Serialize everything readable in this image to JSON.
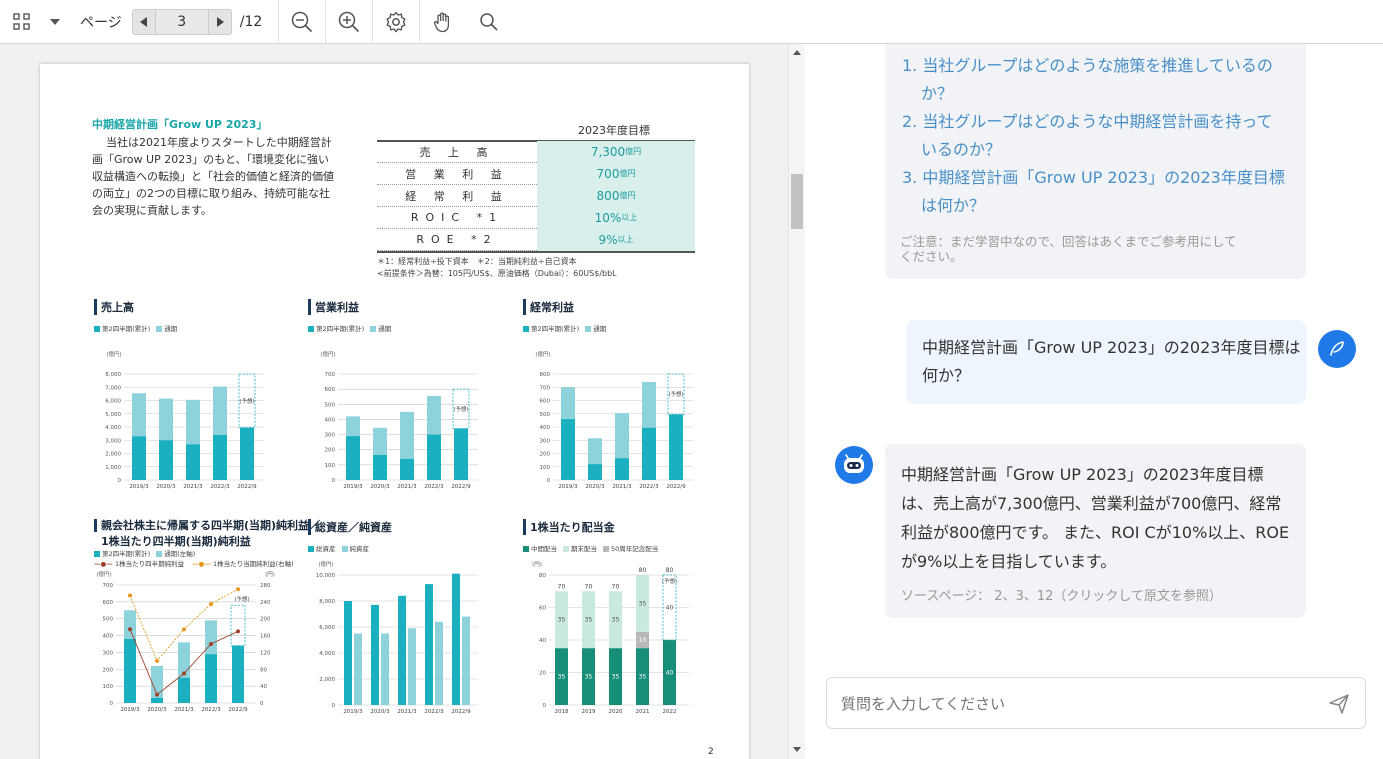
{
  "toolbar": {
    "page_label": "ページ",
    "current_page": "3",
    "total_pages": "/12"
  },
  "pdf": {
    "section_title": "中期経営計画「Grow UP 2023」",
    "intro": [
      "当社は2021年度よりスタートした中期経営計",
      "画「Grow UP 2023」のもと、「環境変化に強い",
      "収益構造への転換」と「社会的価値と経済的価値",
      "の両立」の2つの目標に取り組み、持続可能な社",
      "会の実現に貢献します。"
    ],
    "targets_header": "2023年度目標",
    "targets": [
      {
        "label": "売 上 高",
        "value": "7,300",
        "unit": "億円"
      },
      {
        "label": "営 業 利 益",
        "value": "700",
        "unit": "億円"
      },
      {
        "label": "経 常 利 益",
        "value": "800",
        "unit": "億円"
      },
      {
        "label": "ROIC *1",
        "value": "10%",
        "unit": "以上"
      },
      {
        "label": "ROE *2",
        "value": "9%",
        "unit": "以上"
      }
    ],
    "footnote1": "＊1：経常利益÷投下資本　＊2：当期純利益÷自己資本",
    "footnote2": "<前提条件＞為替：105円/US$、原油価格（Dubai）：60US$/bbL",
    "page_number": "2",
    "colors": {
      "dark": "#1ab0bf",
      "light": "#8ed3dc",
      "green": "#178f78",
      "pale": "#c9e8e0"
    },
    "charts": [
      {
        "title": "売上高",
        "unit": "(億円)",
        "legend": [
          "第2四半期(累計)",
          "通期"
        ],
        "yticks": [
          "8,000",
          "7,000",
          "6,000",
          "5,000",
          "4,000",
          "3,000",
          "2,000",
          "1,000",
          "0"
        ],
        "ymax": 8000,
        "cats": [
          "2019/3",
          "2020/3",
          "2021/3",
          "2022/3",
          "2022/9"
        ],
        "h1": [
          3300,
          3000,
          2700,
          3400,
          3950
        ],
        "total": [
          6550,
          6150,
          6050,
          7050,
          8000
        ],
        "note": "(予想)"
      },
      {
        "title": "営業利益",
        "unit": "(億円)",
        "legend": [
          "第2四半期(累計)",
          "通期"
        ],
        "yticks": [
          "700",
          "600",
          "500",
          "400",
          "300",
          "200",
          "100",
          "0"
        ],
        "ymax": 700,
        "cats": [
          "2019/3",
          "2020/3",
          "2021/3",
          "2022/3",
          "2022/9"
        ],
        "h1": [
          290,
          165,
          140,
          300,
          340
        ],
        "total": [
          420,
          345,
          450,
          555,
          600
        ],
        "note": "(予想)"
      },
      {
        "title": "経常利益",
        "unit": "(億円)",
        "legend": [
          "第2四半期(累計)",
          "通期"
        ],
        "yticks": [
          "800",
          "700",
          "600",
          "500",
          "400",
          "300",
          "200",
          "100",
          "0"
        ],
        "ymax": 800,
        "cats": [
          "2019/3",
          "2020/3",
          "2021/3",
          "2022/3",
          "2022/9"
        ],
        "h1": [
          460,
          120,
          165,
          395,
          495
        ],
        "total": [
          700,
          315,
          505,
          740,
          800
        ],
        "note": "(予想)"
      }
    ],
    "bottom_charts": [
      {
        "title": "親会社株主に帰属する四半期(当期)純利益／",
        "title2": "1株当たり四半期(当期)純利益",
        "legend": [
          "第2四半期(累計)",
          "通期(左軸)",
          "1株当たり四半期純利益",
          "1株当たり当期純利益(右軸)"
        ],
        "unit_l": "(億円)",
        "unit_r": "(円)",
        "yticks": [
          "700",
          "600",
          "500",
          "400",
          "300",
          "200",
          "100",
          "0"
        ],
        "rticks": [
          "280",
          "240",
          "200",
          "160",
          "120",
          "80",
          "40",
          "0"
        ],
        "ymax": 700,
        "cats": [
          "2019/3",
          "2020/3",
          "2021/3",
          "2022/3",
          "2022/9"
        ],
        "h1": [
          380,
          30,
          150,
          290,
          340
        ],
        "total": [
          550,
          220,
          360,
          490,
          580
        ],
        "eps_h1": [
          175,
          20,
          70,
          140,
          170
        ],
        "eps_full": [
          255,
          100,
          175,
          235,
          270
        ],
        "note": "(予想)"
      },
      {
        "title": "総資産／純資産",
        "legend": [
          "総資産",
          "純資産"
        ],
        "unit": "(億円)",
        "yticks": [
          "10,000",
          "8,000",
          "6,000",
          "4,000",
          "2,000",
          "0"
        ],
        "ymax": 10000,
        "cats": [
          "2019/3",
          "2020/3",
          "2021/3",
          "2022/3",
          "2022/9"
        ],
        "a": [
          8000,
          7700,
          8400,
          9300,
          10100
        ],
        "b": [
          5500,
          5500,
          5900,
          6400,
          6800
        ]
      },
      {
        "title": "1株当たり配当金",
        "legend": [
          "中間配当",
          "期末配当",
          "50周年記念配当"
        ],
        "unit": "(円)",
        "yticks": [
          "80",
          "60",
          "40",
          "20",
          "0"
        ],
        "ymax": 80,
        "cats": [
          "2018",
          "2019",
          "2020",
          "2021",
          "2022"
        ],
        "mid": [
          35,
          35,
          35,
          35,
          40
        ],
        "end": [
          35,
          35,
          35,
          35,
          40
        ],
        "anniv": [
          0,
          0,
          0,
          10,
          0
        ],
        "totals": [
          "70",
          "70",
          "70",
          "80",
          "80"
        ],
        "mid_labels": [
          "35",
          "35",
          "35",
          "35",
          "40"
        ],
        "end_labels": [
          "35",
          "35",
          "35",
          "35",
          "40"
        ],
        "anniv_label": "10",
        "note": "(予想)"
      }
    ]
  },
  "chat": {
    "suggestions": [
      "1. 当社グループはどのような施策を推進しているの",
      "か？",
      "2. 当社グループはどのような中期経営計画を持って",
      "いるのか？",
      "3. 中期経営計画「Grow UP 2023」の2023年度目標",
      "は何か？"
    ],
    "disclaimer": [
      "ご注意：まだ学習中なので、回答はあくまでご参考用にして",
      "ください。"
    ],
    "user_message": [
      "中期経営計画「Grow UP 2023」の2023年度目標は",
      "何か？"
    ],
    "bot_answer": [
      "中期経営計画「Grow UP 2023」の2023年度目標",
      "は、売上高が7,300億円、営業利益が700億円、経常",
      "利益が800億円です。 また、ROI Cが10%以上、ROE",
      "が9%以上を目指しています。"
    ],
    "source": "ソースページ：  2、3、12（クリックして原文を参照）",
    "input_placeholder": "質問を入力してください"
  }
}
